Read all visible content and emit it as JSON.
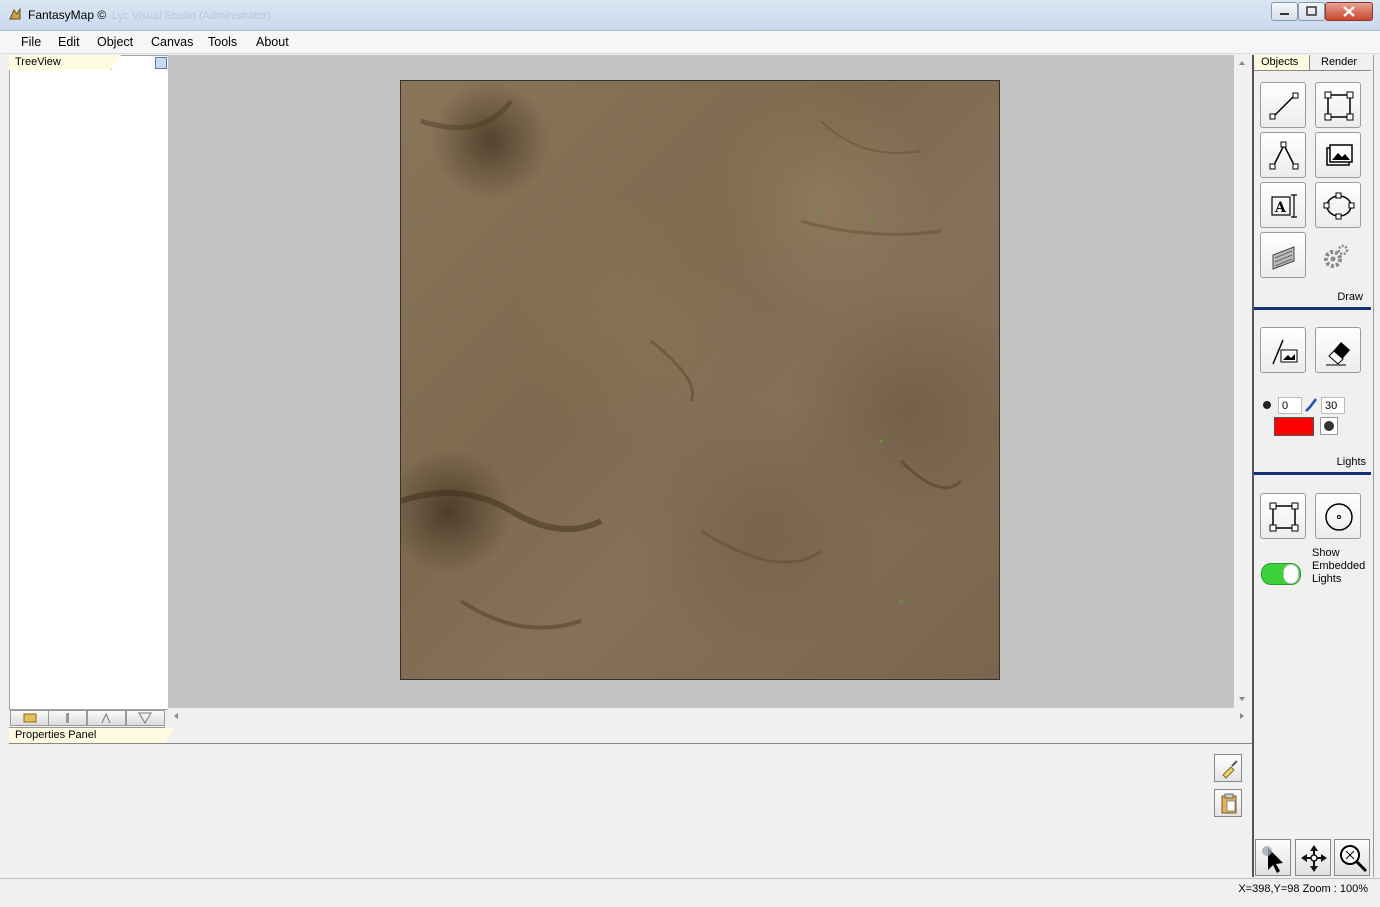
{
  "window": {
    "title": "FantasyMap ©",
    "title_ghost": "Lyc Visual Studio (Administrator)"
  },
  "menu": [
    "File",
    "Edit",
    "Object",
    "Canvas",
    "Tools",
    "About"
  ],
  "treeview": {
    "tab_label": "TreeView"
  },
  "properties": {
    "tab_label": "Properties Panel"
  },
  "right_panel": {
    "tabs": [
      "Objects",
      "Render"
    ],
    "draw_label": "Draw",
    "lights_label": "Lights",
    "brush_size": "0",
    "brush_value": "30",
    "light_color": "#ff0000",
    "embedded_lights_label_1": "Show",
    "embedded_lights_label_2": "Embedded",
    "embedded_lights_label_3": "Lights",
    "embedded_lights_on": true,
    "icons": {
      "draw": [
        "line-icon",
        "select-rect-icon",
        "path-icon",
        "image-icon",
        "text-icon",
        "ellipse-icon",
        "texture-icon",
        "settings-icon"
      ],
      "lights": [
        "light-brush-icon",
        "eraser-icon"
      ],
      "embedded": [
        "light-rect-icon",
        "light-circle-icon"
      ],
      "nav": [
        "pointer-icon",
        "pan-icon",
        "zoom-icon"
      ]
    }
  },
  "status": {
    "text": "X=398,Y=98  Zoom : 100%"
  }
}
